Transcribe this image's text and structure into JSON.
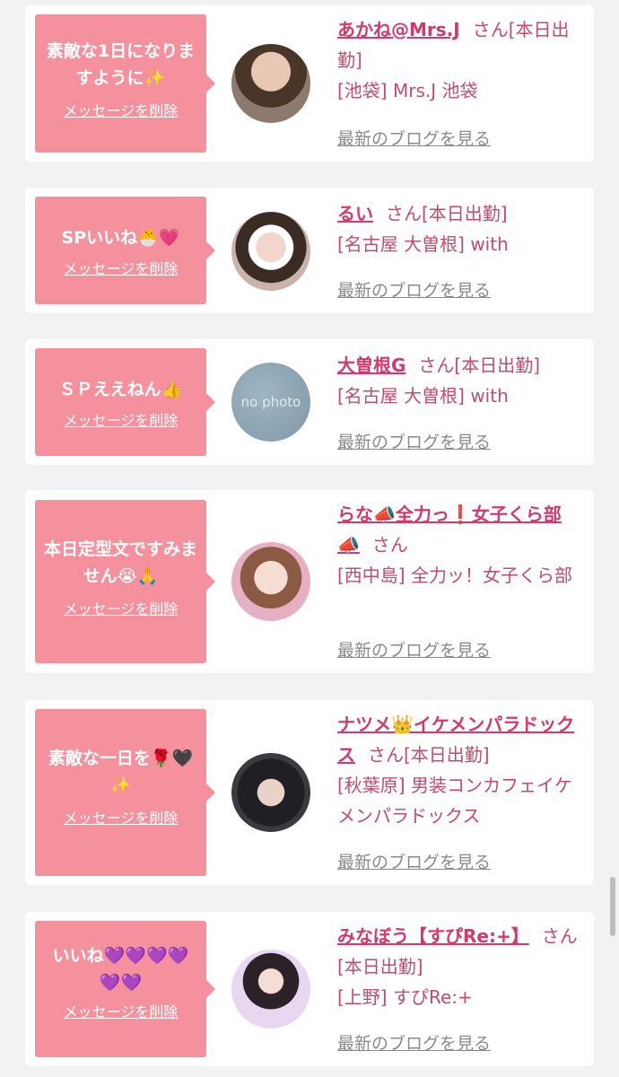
{
  "accent_color": "#f4919d",
  "name_color": "#d6386c",
  "items": [
    {
      "message": "素敵な1日になりますように✨",
      "delete_label": "メッセージを削除",
      "name": "あかね@Mrs.J",
      "suffix": "さん[本日出勤]",
      "shop": "[池袋] Mrs.J 池袋",
      "blog_label": "最新のブログを見る",
      "avatar": "photo"
    },
    {
      "message": "SPいいね🐣💗",
      "delete_label": "メッセージを削除",
      "name": "るい",
      "suffix": "さん[本日出勤]",
      "shop": "[名古屋 大曽根] with",
      "blog_label": "最新のブログを見る",
      "avatar": "photo"
    },
    {
      "message": "ＳＰええねん👍",
      "delete_label": "メッセージを削除",
      "name": "大曽根G",
      "suffix": "さん[本日出勤]",
      "shop": "[名古屋 大曽根] with",
      "blog_label": "最新のブログを見る",
      "avatar": "no photo"
    },
    {
      "message": "本日定型文ですみません😭🙏",
      "delete_label": "メッセージを削除",
      "name": "らな📣全力っ❗女子くら部📣",
      "suffix": "さん",
      "shop": "[西中島] 全力ッ！女子くら部",
      "blog_label": "最新のブログを見る",
      "avatar": "photo"
    },
    {
      "message": "素敵な一日を🌹🖤✨",
      "delete_label": "メッセージを削除",
      "name": "ナツメ👑イケメンパラドックス",
      "suffix": "さん[本日出勤]",
      "shop": "[秋葉原] 男装コンカフェイケメンパラドックス",
      "blog_label": "最新のブログを見る",
      "avatar": "photo"
    },
    {
      "message": "いいね💜💜💜💜💜💜",
      "delete_label": "メッセージを削除",
      "name": "みなぼう【すぴRe:+】",
      "suffix": "さん[本日出勤]",
      "shop": "[上野] すぴRe:+",
      "blog_label": "最新のブログを見る",
      "avatar": "photo"
    }
  ]
}
